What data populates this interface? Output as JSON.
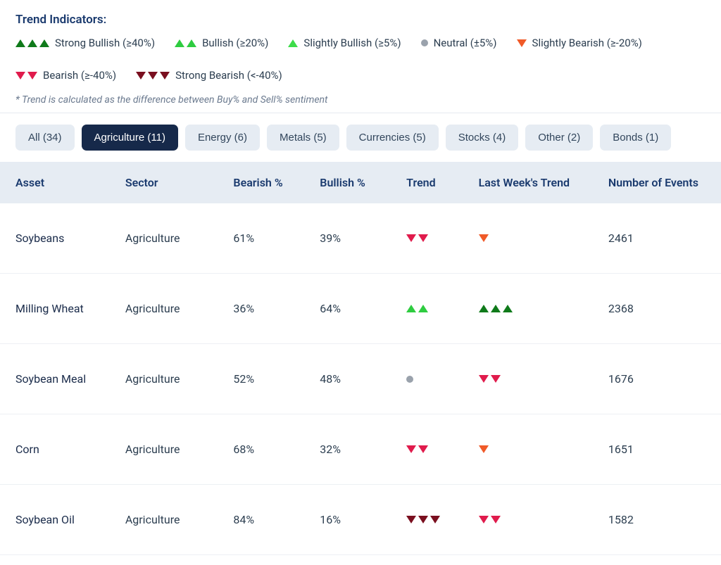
{
  "legend": {
    "title": "Trend Indicators:",
    "items": [
      {
        "icon": "strong-bullish",
        "label": "Strong Bullish (≥40%)"
      },
      {
        "icon": "bullish",
        "label": "Bullish (≥20%)"
      },
      {
        "icon": "slightly-bullish",
        "label": "Slightly Bullish (≥5%)"
      },
      {
        "icon": "neutral",
        "label": "Neutral (±5%)"
      },
      {
        "icon": "slightly-bearish",
        "label": "Slightly Bearish (≥-20%)"
      },
      {
        "icon": "bearish",
        "label": "Bearish (≥-40%)"
      },
      {
        "icon": "strong-bearish",
        "label": "Strong Bearish (<-40%)"
      }
    ],
    "footnote": "* Trend is calculated as the difference between Buy% and Sell% sentiment"
  },
  "filters": [
    {
      "label": "All (34)",
      "active": false
    },
    {
      "label": "Agriculture (11)",
      "active": true
    },
    {
      "label": "Energy (6)",
      "active": false
    },
    {
      "label": "Metals (5)",
      "active": false
    },
    {
      "label": "Currencies (5)",
      "active": false
    },
    {
      "label": "Stocks (4)",
      "active": false
    },
    {
      "label": "Other (2)",
      "active": false
    },
    {
      "label": "Bonds (1)",
      "active": false
    }
  ],
  "columns": {
    "asset": "Asset",
    "sector": "Sector",
    "bearish": "Bearish %",
    "bullish": "Bullish %",
    "trend": "Trend",
    "last": "Last Week's Trend",
    "events": "Number of Events"
  },
  "rows": [
    {
      "asset": "Soybeans",
      "sector": "Agriculture",
      "bearish": "61%",
      "bullish": "39%",
      "trend": "bearish",
      "last": "slightly-bearish",
      "events": "2461"
    },
    {
      "asset": "Milling Wheat",
      "sector": "Agriculture",
      "bearish": "36%",
      "bullish": "64%",
      "trend": "bullish",
      "last": "strong-bullish",
      "events": "2368"
    },
    {
      "asset": "Soybean Meal",
      "sector": "Agriculture",
      "bearish": "52%",
      "bullish": "48%",
      "trend": "neutral",
      "last": "bearish",
      "events": "1676"
    },
    {
      "asset": "Corn",
      "sector": "Agriculture",
      "bearish": "68%",
      "bullish": "32%",
      "trend": "bearish",
      "last": "slightly-bearish",
      "events": "1651"
    },
    {
      "asset": "Soybean Oil",
      "sector": "Agriculture",
      "bearish": "84%",
      "bullish": "16%",
      "trend": "strong-bearish",
      "last": "bearish",
      "events": "1582"
    }
  ]
}
